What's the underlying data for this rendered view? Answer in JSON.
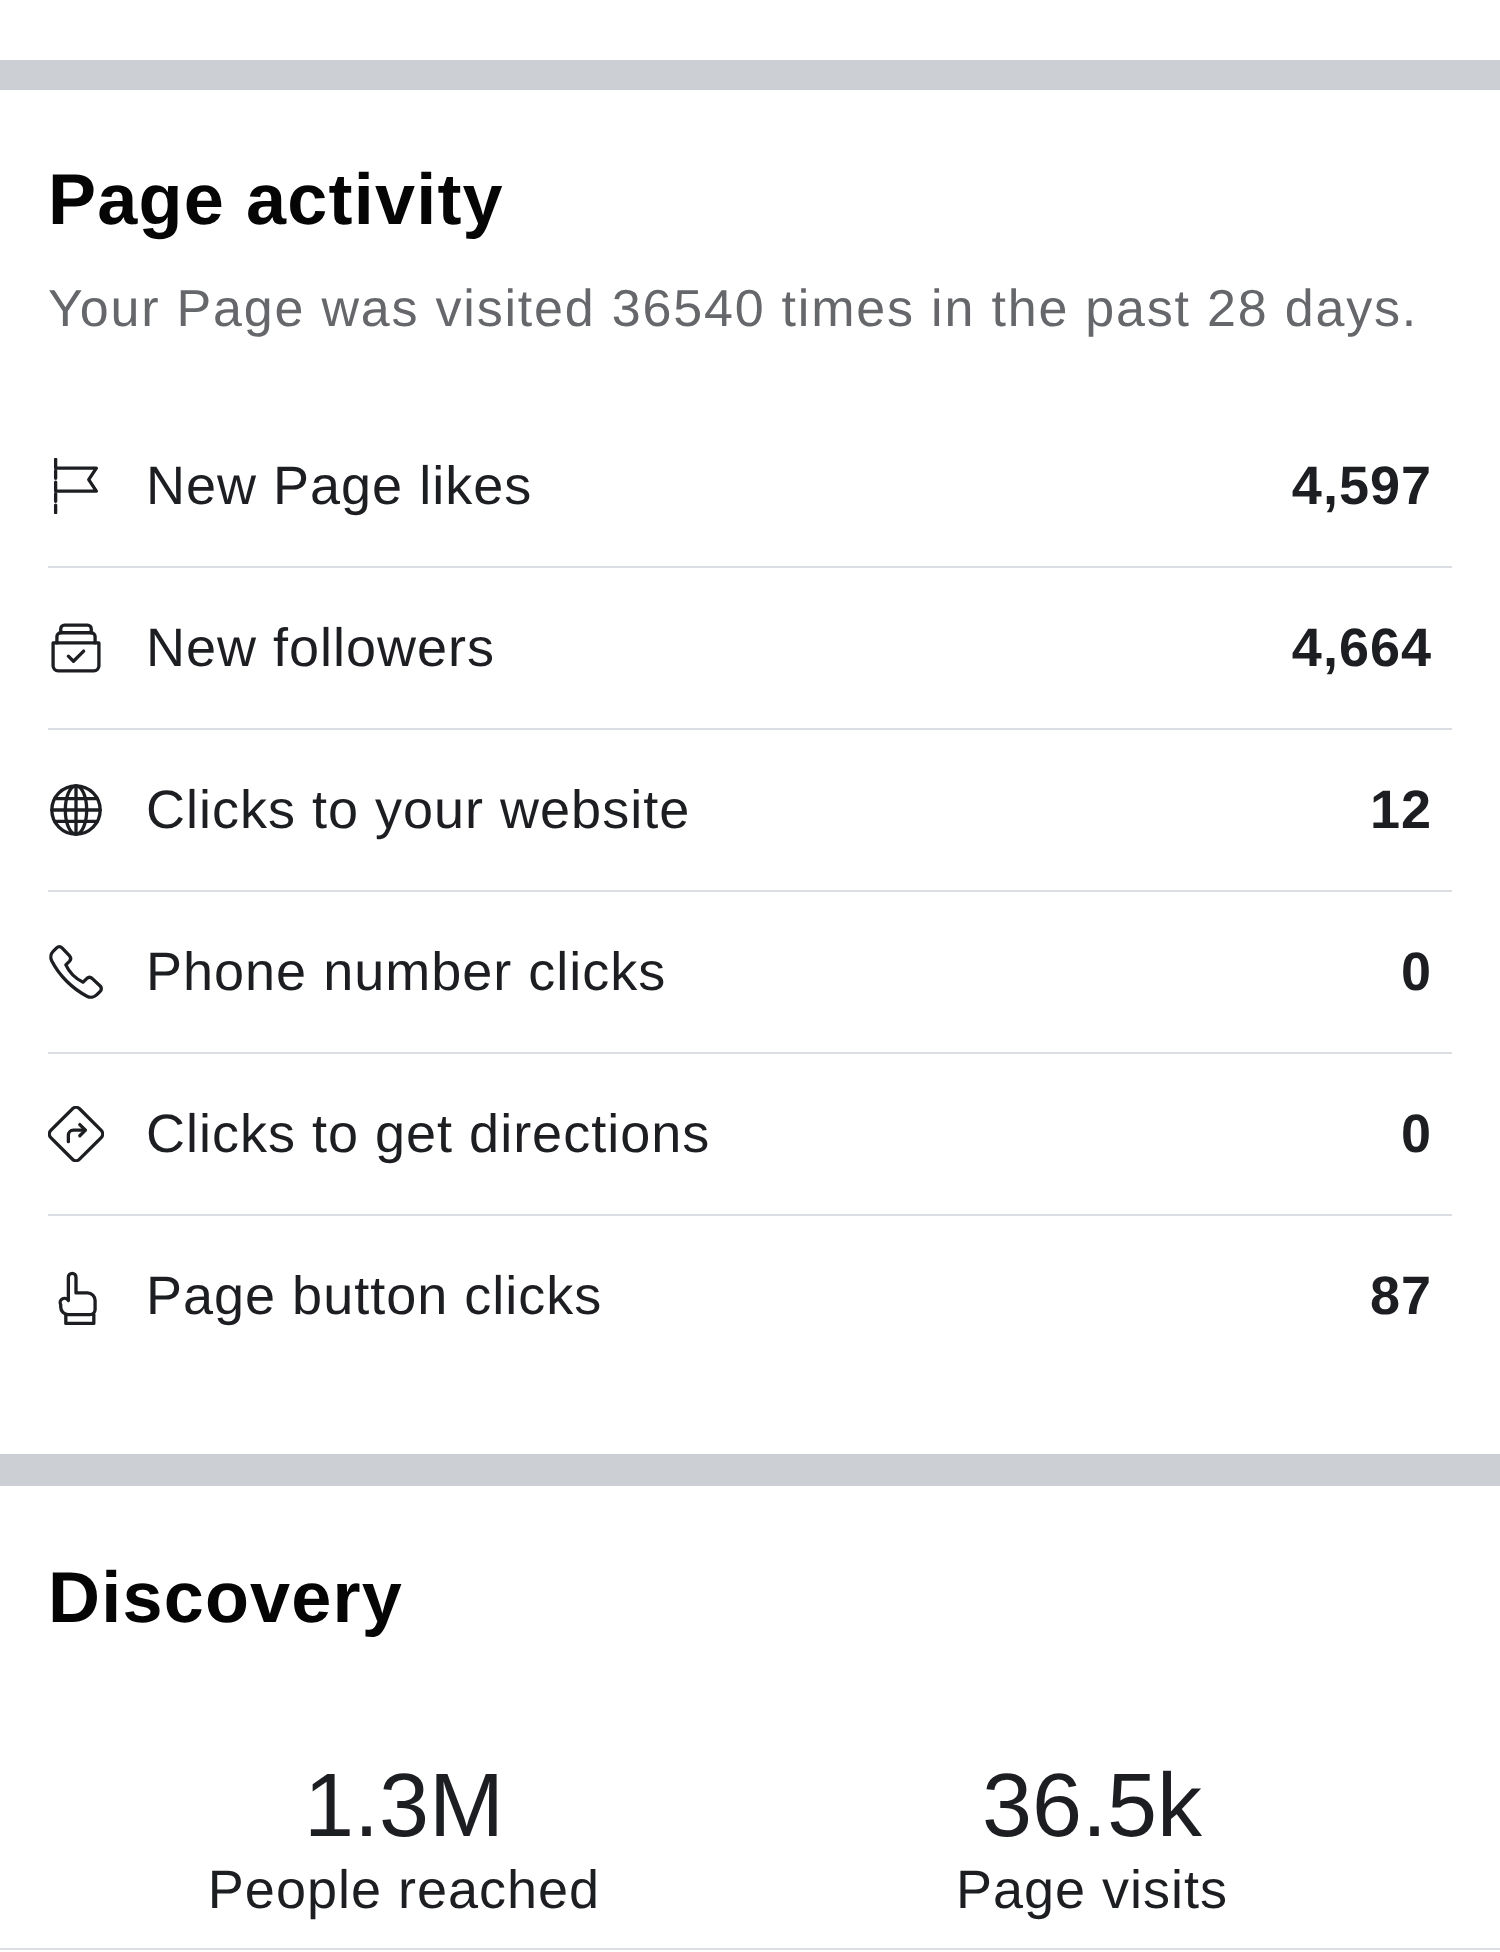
{
  "page_activity": {
    "title": "Page activity",
    "subtitle": "Your Page was visited 36540 times in the past 28 days.",
    "rows": [
      {
        "label": "New Page likes",
        "value": "4,597"
      },
      {
        "label": "New followers",
        "value": "4,664"
      },
      {
        "label": "Clicks to your website",
        "value": "12"
      },
      {
        "label": "Phone number clicks",
        "value": "0"
      },
      {
        "label": "Clicks to get directions",
        "value": "0"
      },
      {
        "label": "Page button clicks",
        "value": "87"
      }
    ]
  },
  "discovery": {
    "title": "Discovery",
    "stats": [
      {
        "value": "1.3M",
        "label": "People reached"
      },
      {
        "value": "36.5k",
        "label": "Page visits"
      }
    ]
  }
}
